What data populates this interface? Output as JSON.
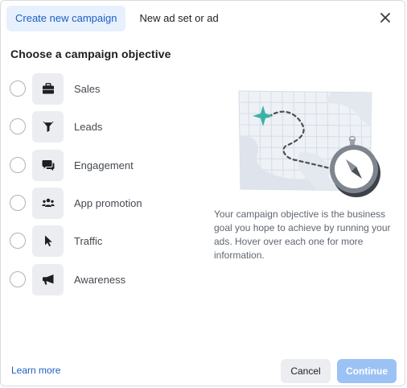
{
  "tabs": [
    {
      "label": "Create new campaign",
      "active": true
    },
    {
      "label": "New ad set or ad",
      "active": false
    }
  ],
  "heading": "Choose a campaign objective",
  "objectives": [
    {
      "label": "Sales",
      "icon": "briefcase-icon"
    },
    {
      "label": "Leads",
      "icon": "funnel-icon"
    },
    {
      "label": "Engagement",
      "icon": "chat-bubbles-icon"
    },
    {
      "label": "App promotion",
      "icon": "people-icon"
    },
    {
      "label": "Traffic",
      "icon": "cursor-icon"
    },
    {
      "label": "Awareness",
      "icon": "megaphone-icon"
    }
  ],
  "description": "Your campaign objective is the business goal you hope to achieve by running your ads. Hover over each one for more information.",
  "footer": {
    "learn_more": "Learn more",
    "cancel": "Cancel",
    "continue": "Continue"
  },
  "colors": {
    "accent": "#1b5fc4",
    "tab_active_bg": "#e7f0fd",
    "continue_disabled": "#9cc2f5",
    "map_marker": "#3ab3a6"
  }
}
